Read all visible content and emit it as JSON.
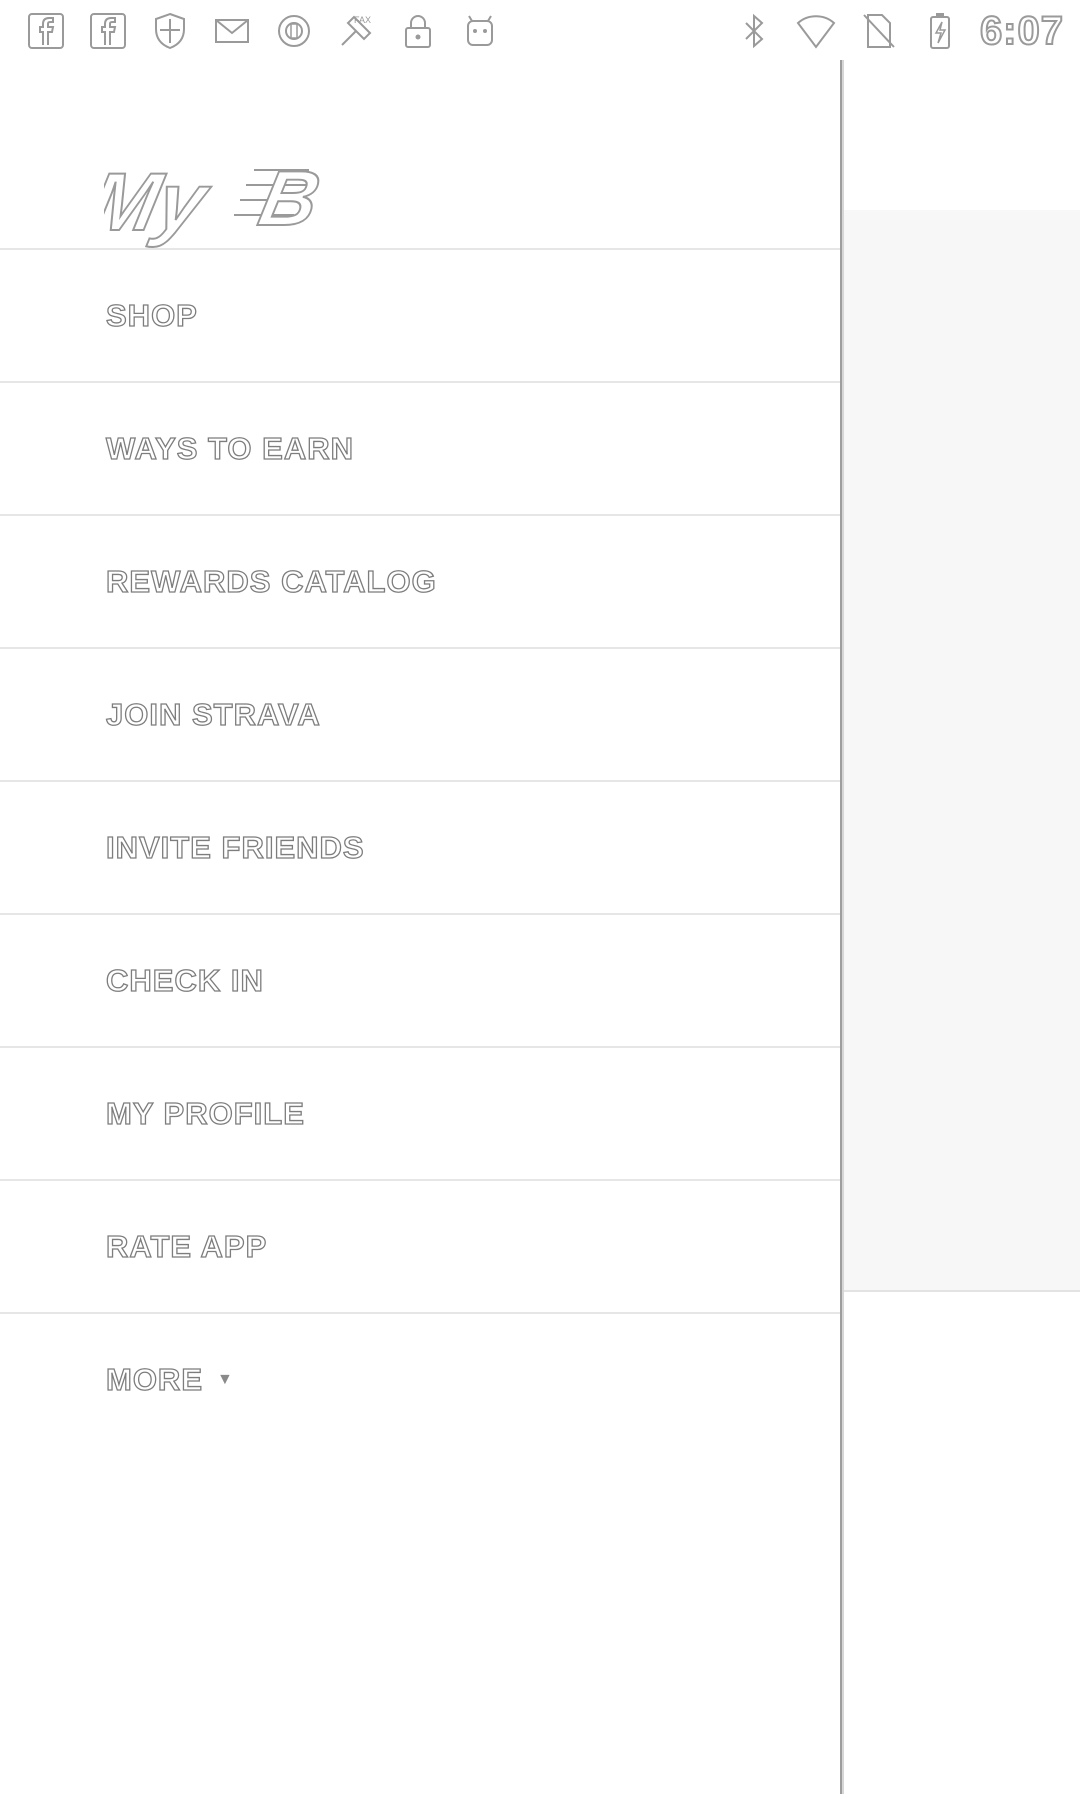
{
  "status_bar": {
    "left_icons": [
      "facebook-icon",
      "facebook-icon",
      "shield-icon",
      "mail-icon",
      "circle-icon",
      "tool-icon",
      "lock-icon",
      "android-icon"
    ],
    "right_icons": [
      "bluetooth-icon",
      "wifi-icon",
      "no-sim-icon",
      "battery-charging-icon"
    ],
    "time": "6:07"
  },
  "drawer": {
    "logo": "MyNB",
    "menu": [
      {
        "label": "SHOP"
      },
      {
        "label": "WAYS TO EARN"
      },
      {
        "label": "REWARDS CATALOG"
      },
      {
        "label": "JOIN STRAVA"
      },
      {
        "label": "INVITE FRIENDS"
      },
      {
        "label": "CHECK IN"
      },
      {
        "label": "MY PROFILE"
      },
      {
        "label": "RATE APP"
      },
      {
        "label": "MORE"
      }
    ]
  },
  "colors": {
    "text_outline": "#7d7d7d",
    "divider": "#e6e6e6",
    "background": "#ffffff"
  }
}
